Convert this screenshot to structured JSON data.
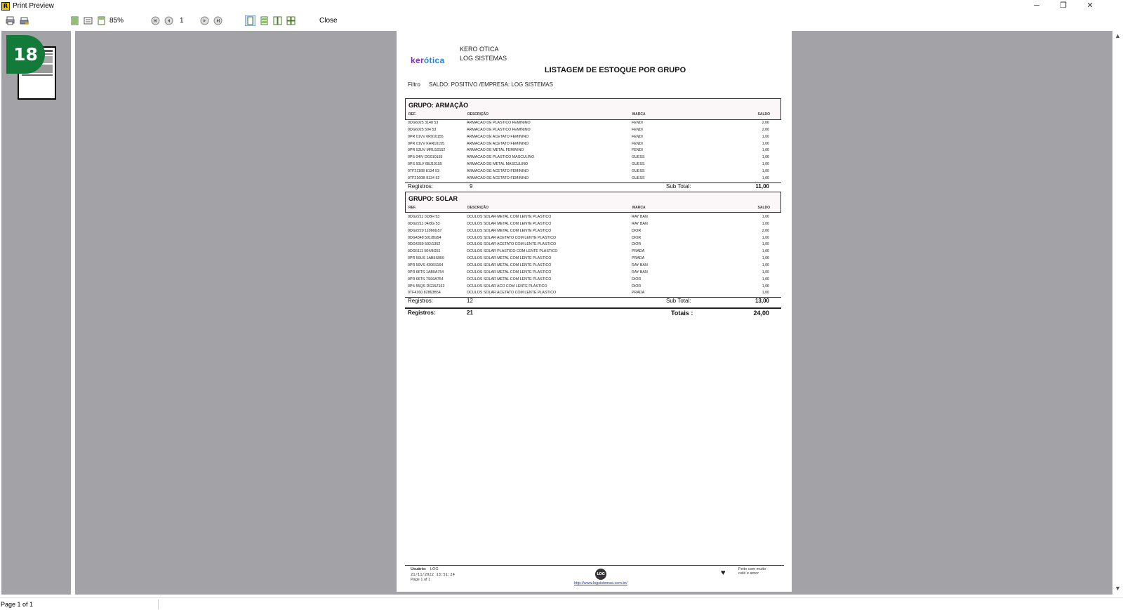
{
  "window": {
    "title": "Print Preview",
    "app_icon_text": "R",
    "minimize": "─",
    "restore": "❐",
    "close": "✕"
  },
  "toolbar": {
    "zoom": "85%",
    "page_number": "1",
    "close_label": "Close"
  },
  "thumbnail": {
    "badge": "18"
  },
  "report": {
    "company_name": "KERO OTICA",
    "company_sub": "LOG SISTEMAS",
    "logo_part1": "ker",
    "logo_part2": "ótica",
    "title": "LISTAGEM DE ESTOQUE POR GRUPO",
    "filter_label": "Filtro",
    "filter_value": "SALDO: POSITIVO /EMPRESA: LOG SISTEMAS",
    "columns": {
      "ref": "REF.",
      "desc": "DESCRIÇÃO",
      "marca": "MARCA",
      "saldo": "SALDO"
    },
    "groups": [
      {
        "title": "GRUPO:  ARMAÇÃO",
        "rows": [
          {
            "ref": "0DG6025 3148  53",
            "desc": "ARMACAO DE PLASTICO FEMININO",
            "marca": "FENDI",
            "saldo": "2,00"
          },
          {
            "ref": "0DG6025 504   53",
            "desc": "ARMACAO DE PLASTICO FEMININO",
            "marca": "FENDI",
            "saldo": "2,00"
          },
          {
            "ref": "0PR 01VV 0R910155",
            "desc": "ARMACAO DE ACETATO FEMININO",
            "marca": "FENDI",
            "saldo": "1,00"
          },
          {
            "ref": "0PR 01VV KHR10155",
            "desc": "ARMACAO DE ACETATO FEMININO",
            "marca": "FENDI",
            "saldo": "1,00"
          },
          {
            "ref": "0PR 53UV MRU10152",
            "desc": "ARMACAO DE METAL FEMININO",
            "marca": "FENDI",
            "saldo": "1,00"
          },
          {
            "ref": "0PS 04IV DG010155",
            "desc": "ARMACAO DE PLASTICO MASCULINO",
            "marca": "GUESS",
            "saldo": "1,00"
          },
          {
            "ref": "0PS 50LV 6BJ10155",
            "desc": "ARMACAO DE METAL MASCULINO",
            "marca": "GUESS",
            "saldo": "1,00"
          },
          {
            "ref": "0TF2116B 8134  53",
            "desc": "ARMACAO DE ACETATO FEMININO",
            "marca": "GUESS",
            "saldo": "1,00"
          },
          {
            "ref": "0TF2160B 8134  52",
            "desc": "ARMACAO DE ACETATO FEMININO",
            "marca": "GUESS",
            "saldo": "1,00"
          }
        ],
        "registros_label": "Registros:",
        "registros": "9",
        "subtotal_label": "Sub Total:",
        "subtotal": "11,00"
      },
      {
        "title": "GRUPO:  SOLAR",
        "rows": [
          {
            "ref": "0DG2211 02/8H 53",
            "desc": "OCULOS SOLAR METAL COM LENTE PLASTICO",
            "marca": "RAY BAN",
            "saldo": "1,00"
          },
          {
            "ref": "0DG2211 04/8G 53",
            "desc": "OCULOS SOLAR METAL COM LENTE PLASTICO",
            "marca": "RAY BAN",
            "saldo": "1,00"
          },
          {
            "ref": "0DG2220 11066G57",
            "desc": "OCULOS SOLAR METAL COM LENTE PLASTICO",
            "marca": "DIOR",
            "saldo": "2,00"
          },
          {
            "ref": "0DG4348 501/8G54",
            "desc": "OCULOS SOLAR ACETATO COM LENTE PLASTICO",
            "marca": "DIOR",
            "saldo": "1,00"
          },
          {
            "ref": "0DG4359 502/1352",
            "desc": "OCULOS SOLAR ACETATO COM LENTE PLASTICO",
            "marca": "DIOR",
            "saldo": "1,00"
          },
          {
            "ref": "0DG6111 504/8G51",
            "desc": "OCULOS SOLAR PLASTICO COM LENTE PLASTICO",
            "marca": "PRADA",
            "saldo": "1,00"
          },
          {
            "ref": "0PR 59US 1AB5S059",
            "desc": "OCULOS SOLAR METAL COM LENTE PLASTICO",
            "marca": "PRADA",
            "saldo": "1,00"
          },
          {
            "ref": "0PR 59VS 4306S164",
            "desc": "OCULOS SOLAR METAL COM LENTE PLASTICO",
            "marca": "RAY BAN",
            "saldo": "1,00"
          },
          {
            "ref": "0PR 66TS 1AB0A754",
            "desc": "OCULOS SOLAR METAL COM LENTE PLASTICO",
            "marca": "RAY BAN",
            "saldo": "1,00"
          },
          {
            "ref": "0PR 66TS 7S00A754",
            "desc": "OCULOS SOLAR METAL COM LENTE PLASTICO",
            "marca": "DIOR",
            "saldo": "1,00"
          },
          {
            "ref": "0PS 55QS DG15Z162",
            "desc": "OCULOS SOLAR ACO COM LENTE PLASTICO",
            "marca": "DIOR",
            "saldo": "1,00"
          },
          {
            "ref": "0TF4160 82863B54",
            "desc": "OCULOS SOLAR ACETATO COM LENTE PLASTICO",
            "marca": "PRADA",
            "saldo": "1,00"
          }
        ],
        "registros_label": "Registros:",
        "registros": "12",
        "subtotal_label": "Sub Total:",
        "subtotal": "13,00"
      }
    ],
    "total_registros_label": "Registros:",
    "total_registros": "21",
    "totais_label": "Totais :",
    "totais": "24,00",
    "footer": {
      "usuario_label": "Usuário:",
      "usuario": "LOG",
      "datetime": "21/11/2022 13:51:24",
      "page": "Page 1 of 1",
      "logo_text": "LOG",
      "link": "http://www.logsistemas.com.br/",
      "made_with": "Feito com muito",
      "made_with2": "café e amor"
    }
  },
  "status": {
    "page_info": "Page 1 of 1"
  },
  "colors": {
    "preview_bg": "#a3a2a6",
    "badge": "#147a3a",
    "logo_purple": "#7a2fbd",
    "logo_blue": "#1e88e5"
  }
}
